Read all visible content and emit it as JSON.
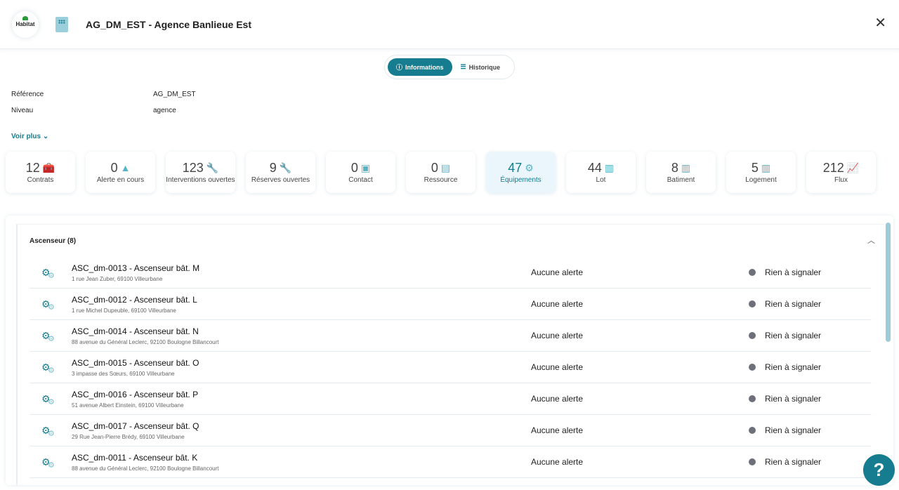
{
  "header": {
    "logo_text": "Habitat",
    "title": "AG_DM_EST - Agence Banlieue Est",
    "close": "✕"
  },
  "tabs": [
    {
      "label": "Informations",
      "icon": "info-icon"
    },
    {
      "label": "Historique",
      "icon": "list-icon"
    }
  ],
  "props": [
    {
      "label": "Référence",
      "value": "AG_DM_EST"
    },
    {
      "label": "Niveau",
      "value": "agence"
    }
  ],
  "voir_plus": "Voir plus",
  "cards": [
    {
      "n": "12",
      "label": "Contrats",
      "icon": "toolbox-icon",
      "g": "🧰"
    },
    {
      "n": "0",
      "label": "Alerte en cours",
      "icon": "warning-icon",
      "g": "▲"
    },
    {
      "n": "123",
      "label": "Interventions ouvertes",
      "icon": "wrench-icon",
      "g": "🔧"
    },
    {
      "n": "9",
      "label": "Réserves ouvertes",
      "icon": "wrench-icon",
      "g": "🔧"
    },
    {
      "n": "0",
      "label": "Contact",
      "icon": "id-badge-icon",
      "g": "▣"
    },
    {
      "n": "0",
      "label": "Ressource",
      "icon": "file-icon",
      "g": "▤"
    },
    {
      "n": "47",
      "label": "Équipements",
      "icon": "gears-icon",
      "g": "⚙"
    },
    {
      "n": "44",
      "label": "Lot",
      "icon": "building-icon",
      "g": "▥"
    },
    {
      "n": "8",
      "label": "Batiment",
      "icon": "building-icon",
      "g": "▥"
    },
    {
      "n": "5",
      "label": "Logement",
      "icon": "building-icon",
      "g": "▥"
    },
    {
      "n": "212",
      "label": "Flux",
      "icon": "chart-line-icon",
      "g": "📈"
    }
  ],
  "group": {
    "title": "Ascenseur (8)"
  },
  "items": [
    {
      "name": "ASC_dm-0013 - Ascenseur bât. M",
      "addr": "1 rue Jean Zuber, 69100 Villeurbane",
      "alert": "Aucune alerte",
      "status": "Rien à signaler"
    },
    {
      "name": "ASC_dm-0012 - Ascenseur bât. L",
      "addr": "1 rue Michel Dupeuble, 69100 Villeurbane",
      "alert": "Aucune alerte",
      "status": "Rien à signaler"
    },
    {
      "name": "ASC_dm-0014 - Ascenseur bât. N",
      "addr": "88 avenue du Général Leclerc, 92100 Boulogne Billancourt",
      "alert": "Aucune alerte",
      "status": "Rien à signaler"
    },
    {
      "name": "ASC_dm-0015 - Ascenseur bât. O",
      "addr": "3 impasse des Sœurs, 69100 Villeurbane",
      "alert": "Aucune alerte",
      "status": "Rien à signaler"
    },
    {
      "name": "ASC_dm-0016 - Ascenseur bât. P",
      "addr": "51 avenue Albert Einstein, 69100 Villeurbane",
      "alert": "Aucune alerte",
      "status": "Rien à signaler"
    },
    {
      "name": "ASC_dm-0017 - Ascenseur bât. Q",
      "addr": "29 Rue Jean-Pierre Brédy, 69100 Villeurbane",
      "alert": "Aucune alerte",
      "status": "Rien à signaler"
    },
    {
      "name": "ASC_dm-0011 - Ascenseur bât. K",
      "addr": "88 avenue du Général Leclerc, 92100 Boulogne Billancourt",
      "alert": "Aucune alerte",
      "status": "Rien à signaler"
    }
  ],
  "help": "?",
  "colors": {
    "accent": "#157d8f"
  }
}
